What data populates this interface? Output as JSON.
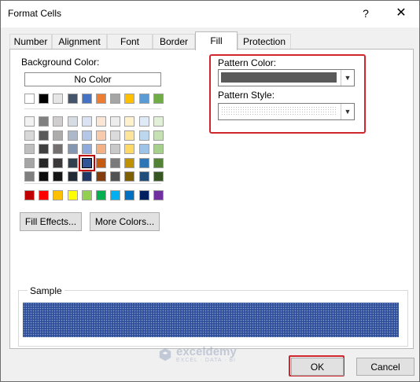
{
  "window": {
    "title": "Format Cells",
    "help": "?",
    "close": "✕"
  },
  "tabs": [
    {
      "label": "Number",
      "active": false
    },
    {
      "label": "Alignment",
      "active": false
    },
    {
      "label": "Font",
      "active": false
    },
    {
      "label": "Border",
      "active": false
    },
    {
      "label": "Fill",
      "active": true
    },
    {
      "label": "Protection",
      "active": false
    }
  ],
  "fill": {
    "background_label": "Background Color:",
    "no_color": "No Color",
    "standard_row": [
      "#ffffff",
      "#000000",
      "#e7e6e6",
      "#44546a",
      "#4472c4",
      "#ed7d31",
      "#a5a5a5",
      "#ffc000",
      "#5b9bd5",
      "#70ad47"
    ],
    "tints": [
      [
        "#f2f2f2",
        "#808080",
        "#d0cece",
        "#d6dce4",
        "#dae3f3",
        "#fbe5d5",
        "#ededed",
        "#fff2cc",
        "#deebf6",
        "#e2efd9"
      ],
      [
        "#d8d8d8",
        "#595959",
        "#aeabab",
        "#adb9ca",
        "#b4c7e7",
        "#f7cbac",
        "#dbdbdb",
        "#fee599",
        "#bdd7ee",
        "#c5e0b3"
      ],
      [
        "#bfbfbf",
        "#3f3f3f",
        "#757070",
        "#8496b0",
        "#8faadc",
        "#f4b183",
        "#c9c9c9",
        "#ffd965",
        "#9dc3e6",
        "#a8d08d"
      ],
      [
        "#a5a5a5",
        "#262626",
        "#3a3838",
        "#323f4f",
        "#2f5597",
        "#c55a11",
        "#7b7b7b",
        "#bf9000",
        "#2e75b5",
        "#538135"
      ],
      [
        "#7f7f7f",
        "#0c0c0c",
        "#171616",
        "#222a35",
        "#1f3864",
        "#833c0b",
        "#525252",
        "#7f6000",
        "#1e4e79",
        "#375623"
      ]
    ],
    "selected_swatch": {
      "row": 3,
      "col": 4
    },
    "standard_colors": [
      "#c00000",
      "#ff0000",
      "#ffc000",
      "#ffff00",
      "#92d050",
      "#00b050",
      "#00b0f0",
      "#0070c0",
      "#002060",
      "#7030a0"
    ],
    "fill_effects_label": "Fill Effects...",
    "more_colors_label": "More Colors...",
    "pattern_color_label": "Pattern Color:",
    "pattern_color_value": "#595959",
    "pattern_style_label": "Pattern Style:",
    "sample_label": "Sample",
    "sample_color": "#2f4f9a"
  },
  "footer": {
    "ok": "OK",
    "cancel": "Cancel"
  },
  "watermark": {
    "name": "exceldemy",
    "tagline": "EXCEL · DATA · BI"
  }
}
